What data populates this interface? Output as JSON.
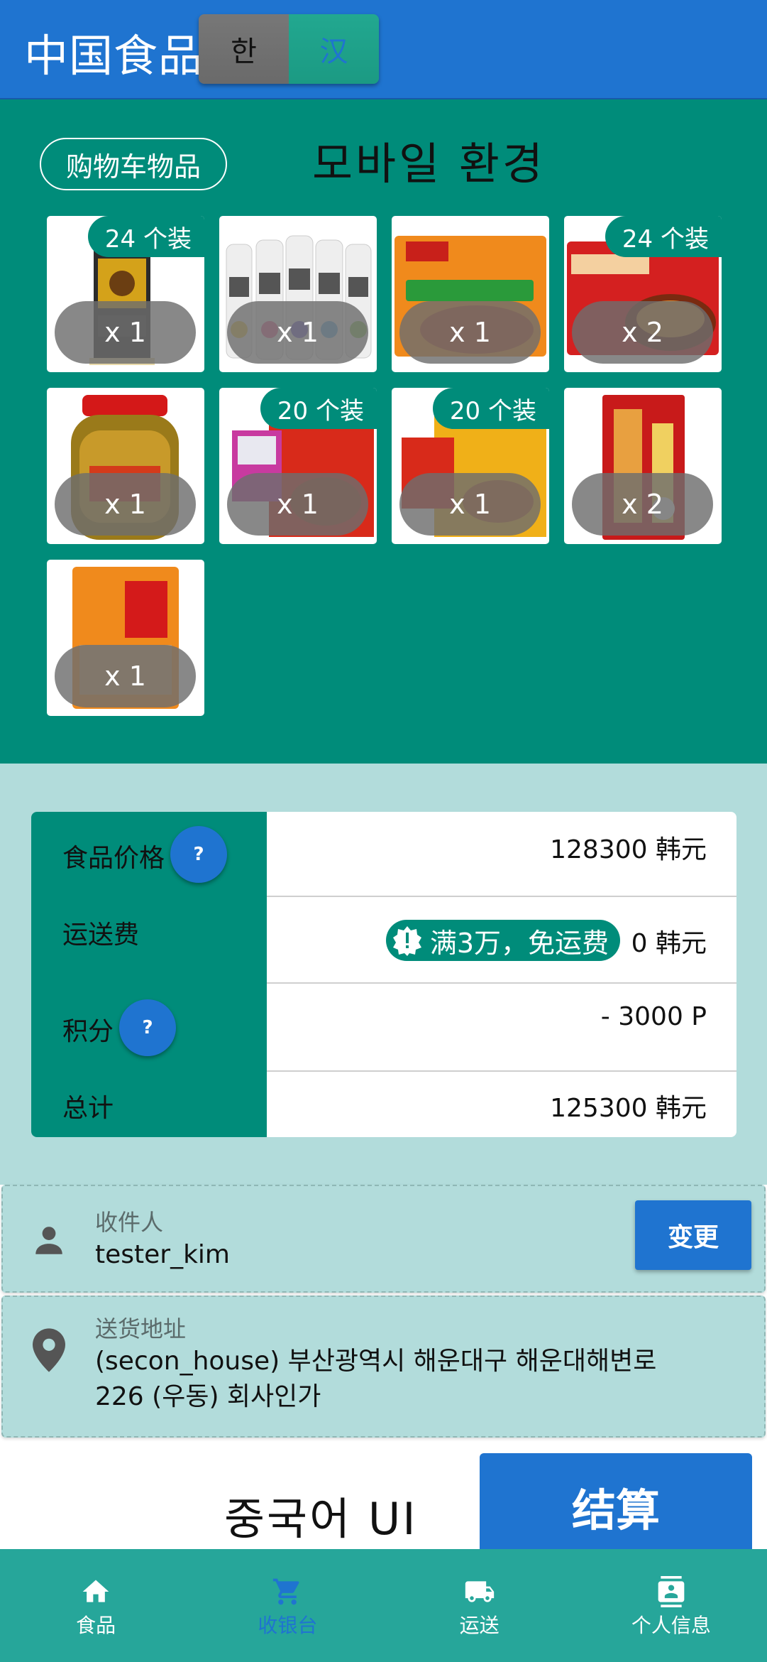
{
  "header": {
    "app_title": "中国食品",
    "lang_ko": "한",
    "lang_zh": "汉"
  },
  "cart": {
    "pill_label": "购物车物品",
    "env_label": "모바일 환경",
    "items": [
      {
        "badge": "24 个装",
        "qty": "x 1",
        "icon": "coconut-drink-can"
      },
      {
        "badge": "",
        "qty": "x 1",
        "icon": "sparkling-water-bottles"
      },
      {
        "badge": "",
        "qty": "x 1",
        "icon": "spicy-beef-noodle-pack"
      },
      {
        "badge": "24 个装",
        "qty": "x 2",
        "icon": "braised-beef-noodle-pack"
      },
      {
        "badge": "",
        "qty": "x 1",
        "icon": "pickled-vegetable-jar"
      },
      {
        "badge": "20 个装",
        "qty": "x 1",
        "icon": "snack-box-red"
      },
      {
        "badge": "20 个装",
        "qty": "x 1",
        "icon": "snack-box-yellow"
      },
      {
        "badge": "",
        "qty": "x 2",
        "icon": "sunflower-seeds-bag"
      },
      {
        "badge": "",
        "qty": "x 1",
        "icon": "tofu-snack-bag"
      }
    ]
  },
  "summary": {
    "food_price_label": "食品价格",
    "food_price_value": "128300 韩元",
    "shipping_label": "运送费",
    "free_shipping_badge": "满3万，免运费",
    "shipping_value": "0 韩元",
    "points_label": "积分",
    "points_value": "- 3000 P",
    "total_label": "总计",
    "total_value": "125300 韩元",
    "help_text": "?"
  },
  "recipient": {
    "label": "收件人",
    "value": "tester_kim",
    "change_button": "变更"
  },
  "address": {
    "label": "送货地址",
    "line1": "(secon_house) 부산광역시 해운대구 해운대해변로",
    "line2": "226  (우동) 회사인가"
  },
  "footer": {
    "ui_label": "중국어 UI",
    "checkout_button": "结算"
  },
  "nav": [
    {
      "label": "食品",
      "icon": "home-icon",
      "active": false
    },
    {
      "label": "收银台",
      "icon": "cart-icon",
      "active": true
    },
    {
      "label": "运送",
      "icon": "truck-icon",
      "active": false
    },
    {
      "label": "个人信息",
      "icon": "contact-icon",
      "active": false
    }
  ],
  "colors": {
    "primary_blue": "#1f74d0",
    "teal": "#008c7a",
    "light_teal": "#b2dcdb",
    "nav_teal": "#26a69a"
  }
}
